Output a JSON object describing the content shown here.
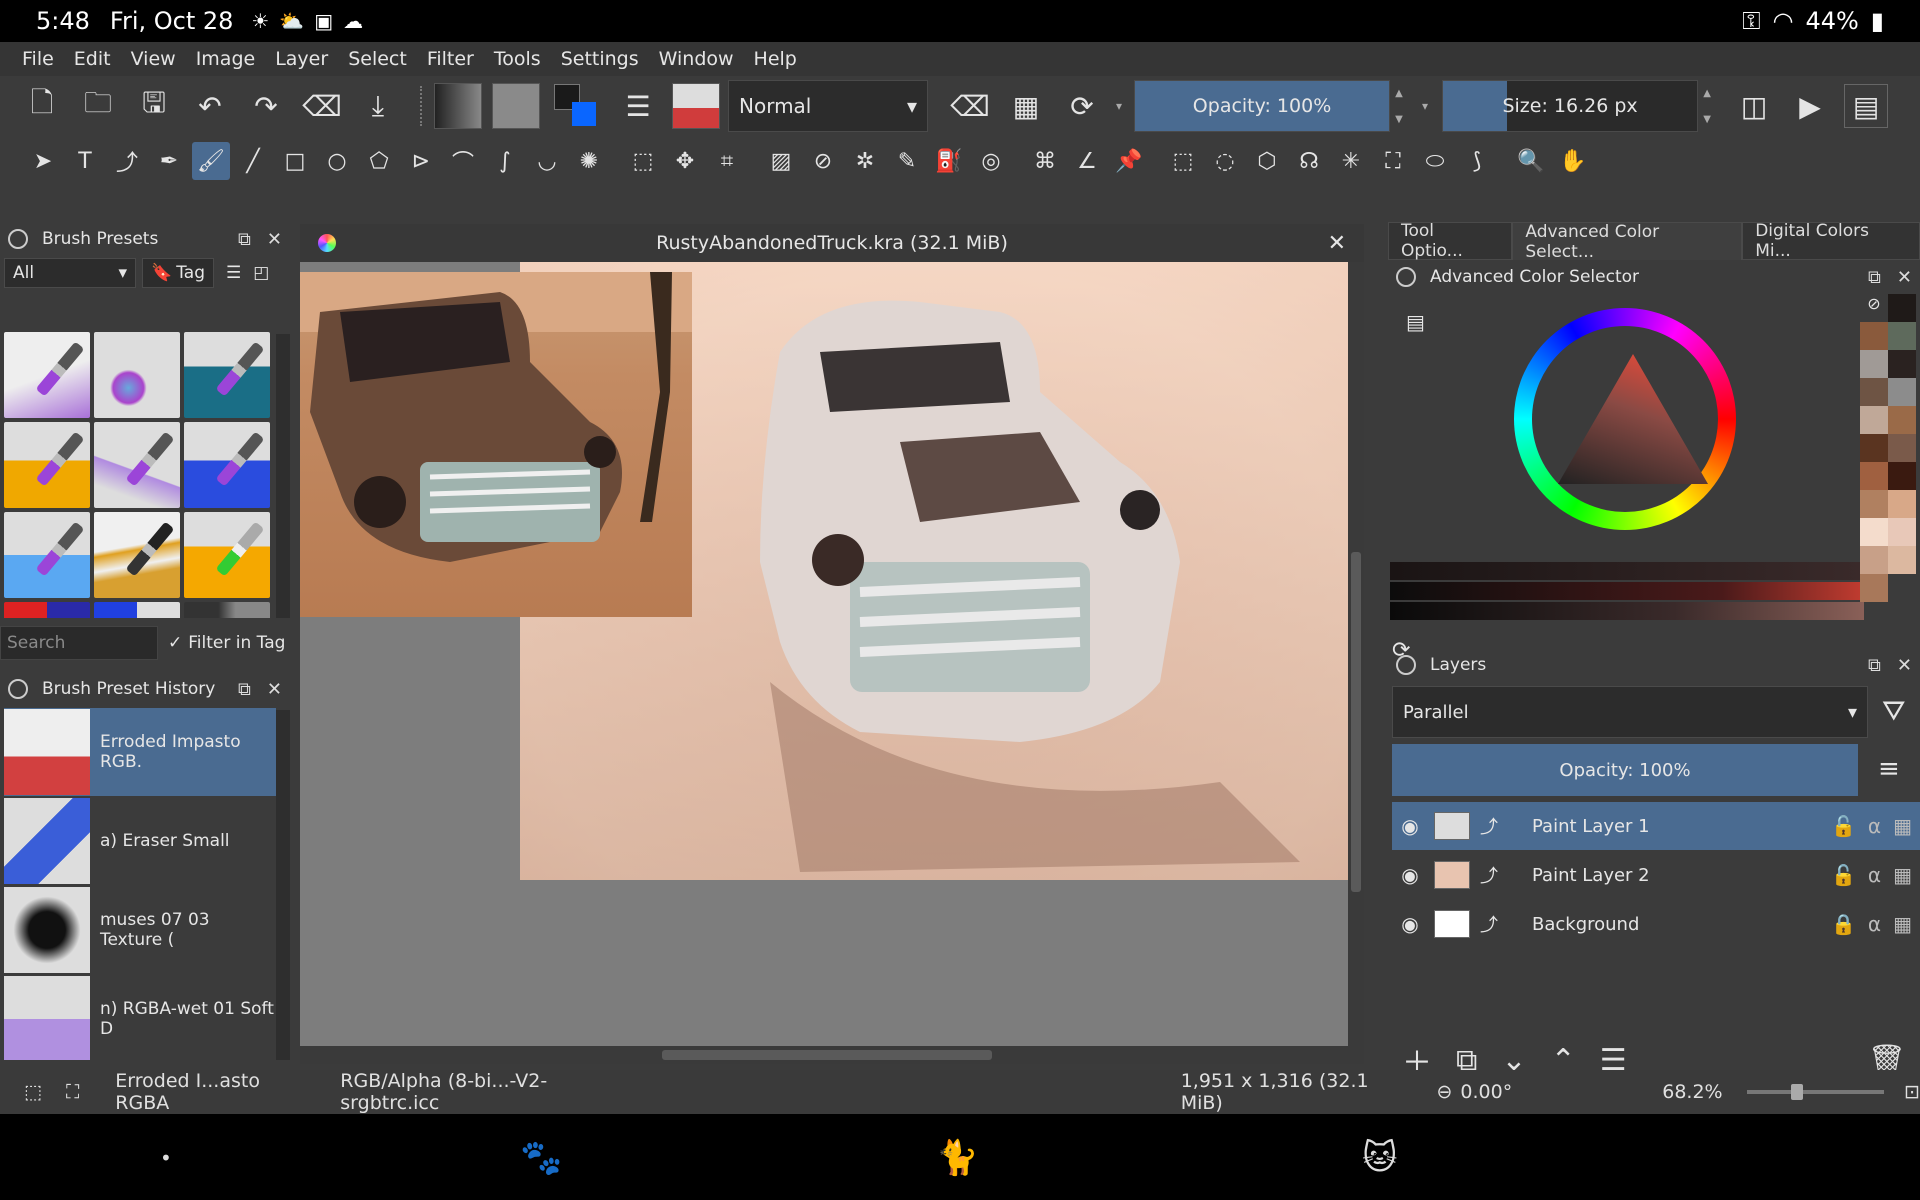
{
  "system_status": {
    "time": "5:48",
    "date": "Fri, Oct 28",
    "battery": "44%",
    "icons": [
      "sun-icon",
      "cloud-sun-icon",
      "gallery-icon",
      "cloud-icon"
    ]
  },
  "menu": [
    "File",
    "Edit",
    "View",
    "Image",
    "Layer",
    "Select",
    "Filter",
    "Tools",
    "Settings",
    "Window",
    "Help"
  ],
  "toolbar": {
    "blend_mode": "Normal",
    "opacity": "Opacity: 100%",
    "opacity_fraction": 1.0,
    "size": "Size: 16.26 px",
    "size_fraction": 0.25
  },
  "brush_presets": {
    "title": "Brush Presets",
    "filter": "All",
    "tag_label": "Tag",
    "search_placeholder": "Search",
    "filter_in_tag": "Filter in Tag"
  },
  "history": {
    "title": "Brush Preset History",
    "items": [
      "Erroded Impasto RGB.",
      "a) Eraser Small",
      "muses 07 03 Texture (",
      "n) RGBA-wet 01 Soft D"
    ]
  },
  "canvas": {
    "title": "RustyAbandonedTruck.kra (32.1 MiB)"
  },
  "right_tabs": [
    "Tool Optio...",
    "Advanced Color Select...",
    "Digital Colors Mi..."
  ],
  "color_selector": {
    "title": "Advanced Color Selector",
    "accent": "#4a6b91"
  },
  "layers": {
    "title": "Layers",
    "mode": "Parallel",
    "opacity": "Opacity:  100%",
    "items": [
      "Paint Layer 1",
      "Paint Layer 2",
      "Background"
    ]
  },
  "status": {
    "brush": "Erroded I...asto RGBA",
    "profile": "RGB/Alpha (8-bi...-V2-srgbtrc.icc",
    "dimensions": "1,951 x 1,316 (32.1 MiB)",
    "rotation": "0.00°",
    "zoom": "68.2%"
  }
}
